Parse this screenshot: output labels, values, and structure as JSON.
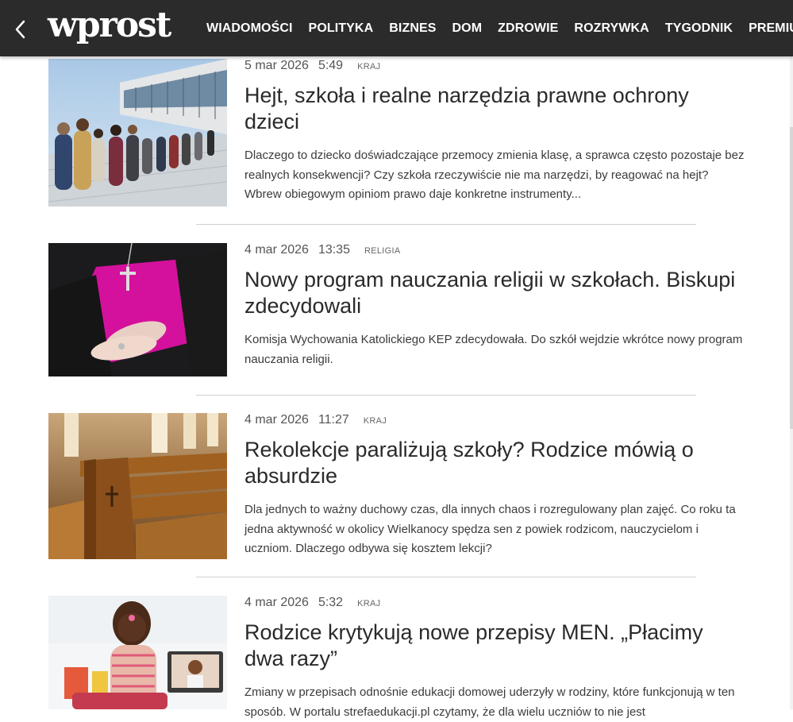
{
  "header": {
    "logo": "wprost",
    "nav": [
      "WIADOMOŚCI",
      "POLITYKA",
      "BIZNES",
      "DOM",
      "ZDROWIE",
      "ROZRYWKA",
      "TYGODNIK",
      "PREMIUM"
    ]
  },
  "articles": [
    {
      "date": "5 mar 2026",
      "time": "5:49",
      "category": "KRAJ",
      "title": "Hejt, szkoła i realne narzędzia prawne ochrony dzieci",
      "lead": "Dlaczego to dziecko doświadczające przemocy zmienia klasę, a sprawca często pozostaje bez realnych konsekwencji? Czy szkoła rzeczywiście nie ma narzędzi, by reagować na hejt? Wbrew obiegowym opiniom prawo daje konkretne instrumenty..."
    },
    {
      "date": "4 mar 2026",
      "time": "13:35",
      "category": "RELIGIA",
      "title": "Nowy program nauczania religii w szkołach. Biskupi zdecydowali",
      "lead": "Komisja Wychowania Katolickiego KEP zdecydowała. Do szkół wejdzie wkrótce nowy program nauczania religii."
    },
    {
      "date": "4 mar 2026",
      "time": "11:27",
      "category": "KRAJ",
      "title": "Rekolekcje paraliżują szkoły? Rodzice mówią o absurdzie",
      "lead": "Dla jednych to ważny duchowy czas, dla innych chaos i rozregulowany plan zajęć. Co roku ta jedna aktywność w okolicy Wielkanocy spędza sen z powiek rodzicom, nauczycielom i uczniom. Dlaczego odbywa się kosztem lekcji?"
    },
    {
      "date": "4 mar 2026",
      "time": "5:32",
      "category": "KRAJ",
      "title": "Rodzice krytykują nowe przepisy MEN. „Płacimy dwa razy”",
      "lead": "Zmiany w przepisach odnośnie edukacji domowej uderzyły w rodziny, które funkcjonują w ten sposób. W portalu strefaedukacji.pl czytamy, że dla wielu uczniów to nie jest"
    }
  ]
}
